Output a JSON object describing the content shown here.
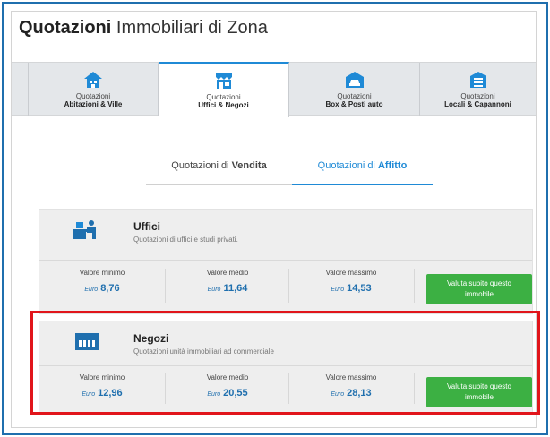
{
  "page": {
    "title_bold": "Quotazioni",
    "title_rest": " Immobiliari di Zona"
  },
  "tabs": [
    {
      "line1": "Quotazioni",
      "line2": "Abitazioni & Ville",
      "icon": "house-icon",
      "active": false
    },
    {
      "line1": "Quotazioni",
      "line2": "Uffici & Negozi",
      "icon": "shop-icon",
      "active": true
    },
    {
      "line1": "Quotazioni",
      "line2": "Box & Posti auto",
      "icon": "garage-icon",
      "active": false
    },
    {
      "line1": "Quotazioni",
      "line2": "Locali & Capannoni",
      "icon": "warehouse-icon",
      "active": false
    }
  ],
  "subtabs": [
    {
      "prefix": "Quotazioni di ",
      "bold": "Vendita",
      "active": false
    },
    {
      "prefix": "Quotazioni di ",
      "bold": "Affitto",
      "active": true
    }
  ],
  "cards": [
    {
      "name": "Uffici",
      "description": "Quotazioni di uffici e studi privati.",
      "icon": "office-desk-icon",
      "metrics": [
        {
          "label": "Valore minimo",
          "currency": "Euro",
          "value": "8,76"
        },
        {
          "label": "Valore medio",
          "currency": "Euro",
          "value": "11,64"
        },
        {
          "label": "Valore massimo",
          "currency": "Euro",
          "value": "14,53"
        }
      ],
      "cta_line1": "Valuta subito questo",
      "cta_line2": "immobile"
    },
    {
      "name": "Negozi",
      "description": "Quotazioni unità immobiliari ad commerciale",
      "icon": "storefront-icon",
      "metrics": [
        {
          "label": "Valore minimo",
          "currency": "Euro",
          "value": "12,96"
        },
        {
          "label": "Valore medio",
          "currency": "Euro",
          "value": "20,55"
        },
        {
          "label": "Valore massimo",
          "currency": "Euro",
          "value": "28,13"
        }
      ],
      "cta_line1": "Valuta subito questo",
      "cta_line2": "immobile"
    }
  ],
  "colors": {
    "accent_blue": "#1f8ad6",
    "value_blue": "#1f6fae",
    "cta_green": "#3cb043",
    "highlight_red": "#e1151b"
  }
}
